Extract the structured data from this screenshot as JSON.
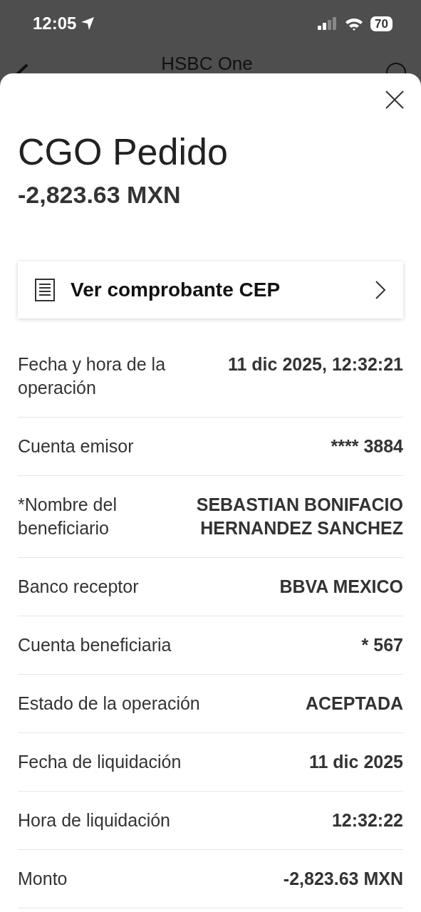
{
  "status_bar": {
    "time": "12:05",
    "battery": "70"
  },
  "app_header": {
    "title": "HSBC One"
  },
  "sheet": {
    "title": "CGO Pedido",
    "amount": "-2,823.63 MXN",
    "receipt_button": {
      "label": "Ver comprobante CEP"
    },
    "details": [
      {
        "label": "Fecha y hora de la operación",
        "value": "11 dic 2025, 12:32:21"
      },
      {
        "label": "Cuenta emisor",
        "value": "**** 3884"
      },
      {
        "label": "*Nombre del beneficiario",
        "value": "SEBASTIAN BONIFACIO HERNANDEZ SANCHEZ"
      },
      {
        "label": "Banco receptor",
        "value": "BBVA MEXICO"
      },
      {
        "label": "Cuenta beneficiaria",
        "value": "* 567"
      },
      {
        "label": "Estado de la operación",
        "value": "ACEPTADA"
      },
      {
        "label": "Fecha de liquidación",
        "value": "11 dic 2025"
      },
      {
        "label": "Hora de liquidación",
        "value": "12:32:22"
      },
      {
        "label": "Monto",
        "value": "-2,823.63 MXN"
      }
    ]
  }
}
